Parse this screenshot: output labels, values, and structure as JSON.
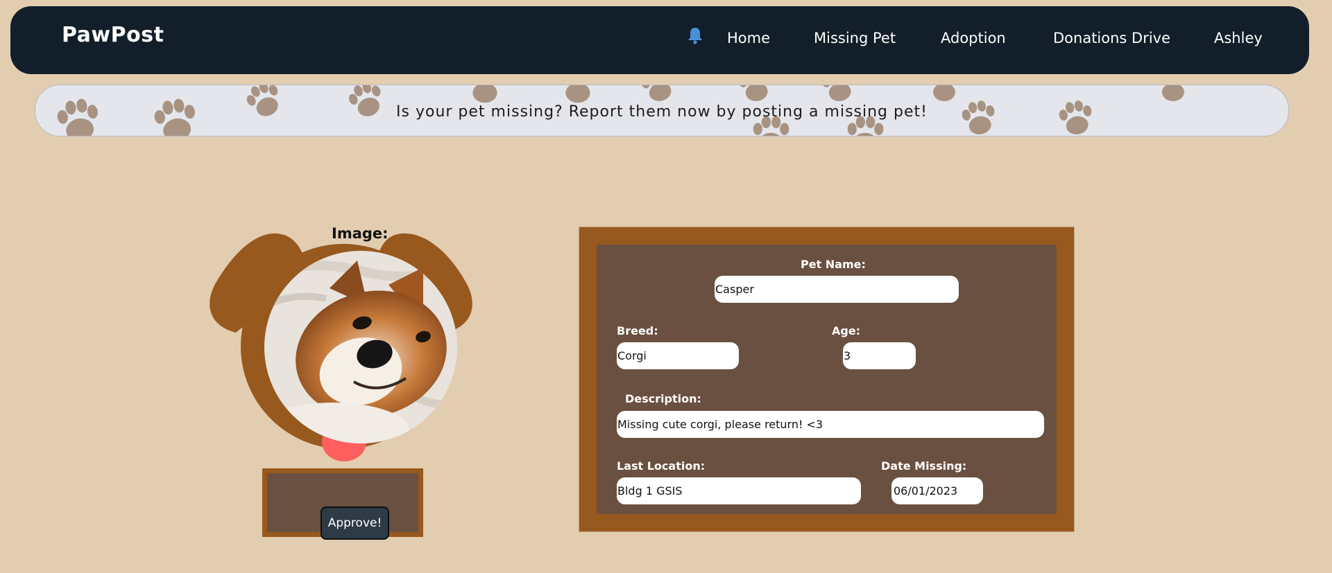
{
  "navbar": {
    "brand": "PawPost",
    "bell_icon": "bell-icon",
    "links": [
      "Home",
      "Missing Pet",
      "Adoption",
      "Donations Drive",
      "Ashley"
    ]
  },
  "banner": {
    "text": "Is your pet missing? Report them now by posting a missing pet!",
    "background_icon": "paw-print-icon"
  },
  "pet_card": {
    "image_label": "Image:",
    "approve_label": "Approve!"
  },
  "form": {
    "pet_name": {
      "label": "Pet Name:",
      "value": "Casper"
    },
    "breed": {
      "label": "Breed:",
      "value": "Corgi"
    },
    "age": {
      "label": "Age:",
      "value": "3"
    },
    "description": {
      "label": "Description:",
      "value": "Missing cute corgi, please return! <3"
    },
    "last_location": {
      "label": "Last Location:",
      "value": "Bldg 1 GSIS"
    },
    "date_missing": {
      "label": "Date Missing:",
      "value": "06/01/2023"
    }
  },
  "colors": {
    "page_bg": "#e3cdb1",
    "navbar_bg": "#121f2a",
    "bell": "#4a90d9",
    "card_frame": "#98591e",
    "card_inner": "#6a5040",
    "collar_tag": "#ff5f5f",
    "button_bg": "#2e3a45"
  }
}
